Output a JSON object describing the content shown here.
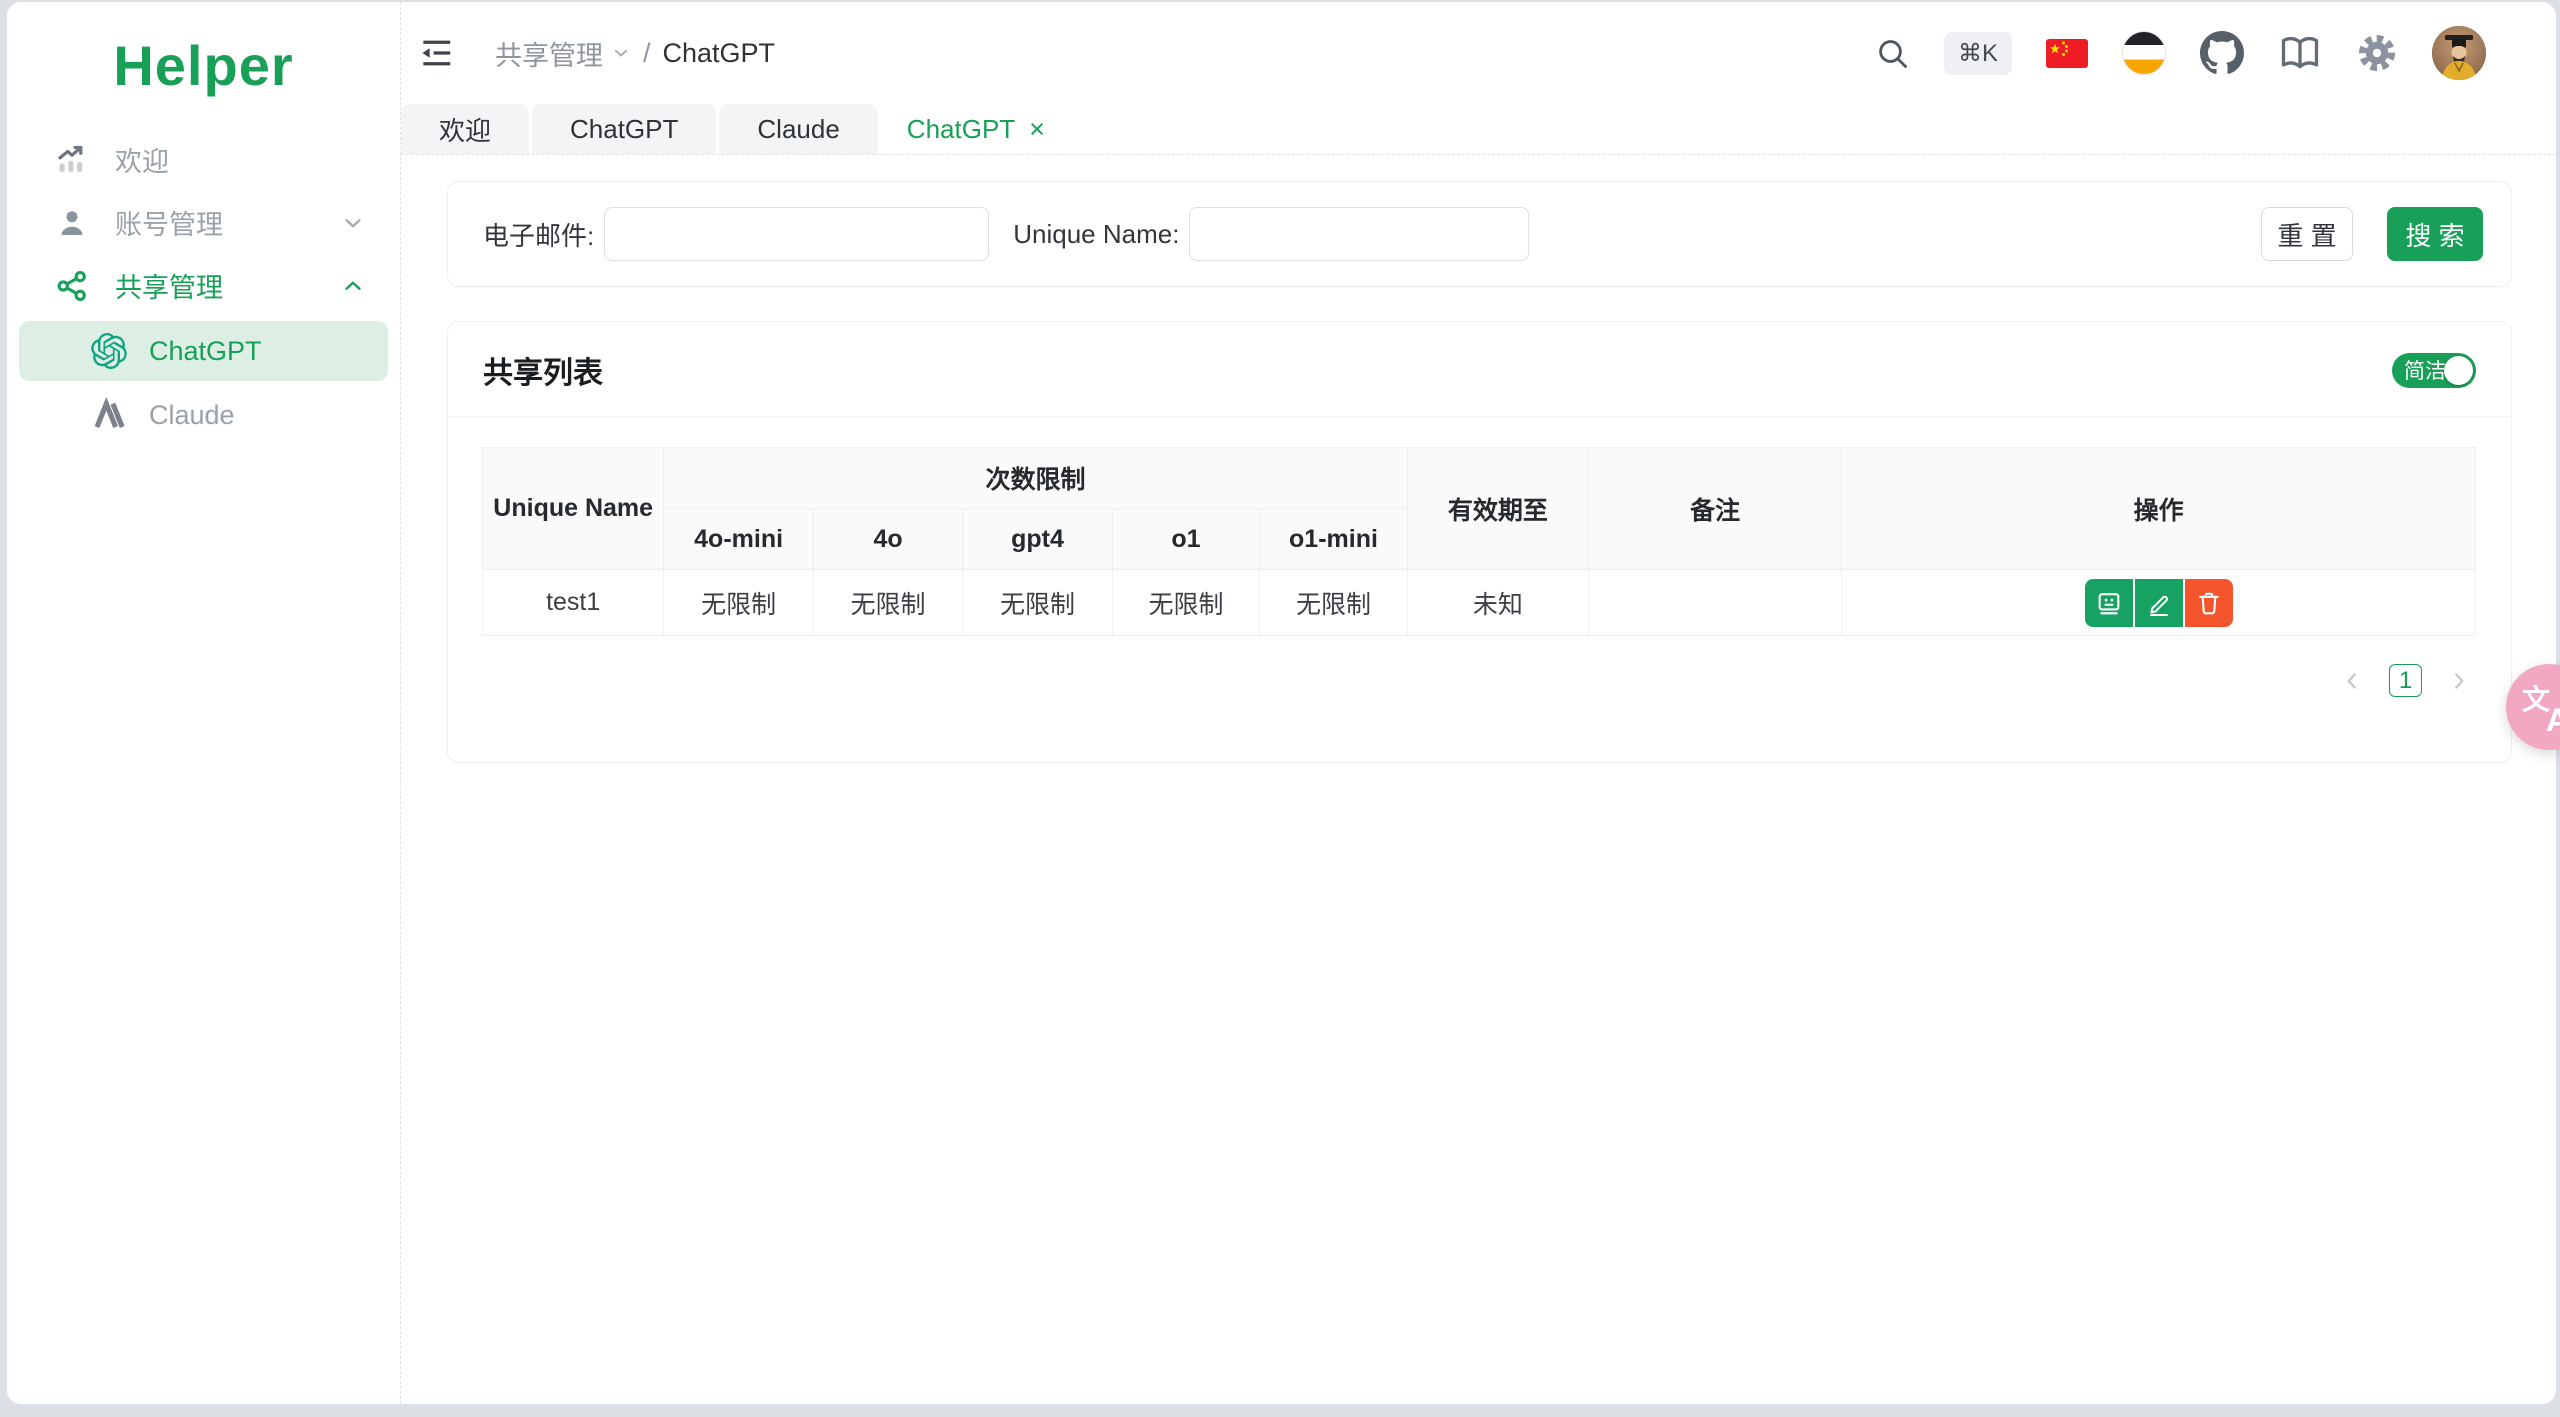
{
  "app": {
    "logo": "Helper"
  },
  "sidebar": {
    "items": [
      {
        "label": "欢迎",
        "icon": "trend-chart-icon"
      },
      {
        "label": "账号管理",
        "icon": "user-icon",
        "chevron": "down"
      },
      {
        "label": "共享管理",
        "icon": "share-icon",
        "chevron": "up"
      }
    ],
    "subitems": [
      {
        "label": "ChatGPT",
        "icon": "openai-icon",
        "active": true
      },
      {
        "label": "Claude",
        "icon": "anthropic-icon",
        "active": false
      }
    ]
  },
  "header": {
    "breadcrumb": {
      "section": "共享管理",
      "sep": "/",
      "page": "ChatGPT"
    },
    "shortcut": "⌘K",
    "icons": [
      "search-icon",
      "shortcut-badge",
      "flag-china-icon",
      "flag-circle-icon",
      "github-icon",
      "docs-book-icon",
      "gear-icon",
      "user-avatar"
    ]
  },
  "tabs": [
    {
      "label": "欢迎",
      "active": false
    },
    {
      "label": "ChatGPT",
      "active": false
    },
    {
      "label": "Claude",
      "active": false
    },
    {
      "label": "ChatGPT",
      "active": true,
      "close": "×"
    }
  ],
  "filter": {
    "email_label": "电子邮件:",
    "email_value": "",
    "unique_label": "Unique Name:",
    "unique_value": "",
    "reset": "重 置",
    "search": "搜 索"
  },
  "list": {
    "title": "共享列表",
    "toggle_label": "简洁",
    "toggle_on": true
  },
  "table": {
    "col_unique": "Unique Name",
    "col_limit": "次数限制",
    "sub_cols": [
      "4o-mini",
      "4o",
      "gpt4",
      "o1",
      "o1-mini"
    ],
    "col_expiry": "有效期至",
    "col_note": "备注",
    "col_actions": "操作",
    "rows": [
      {
        "unique": "test1",
        "limits": [
          "无限制",
          "无限制",
          "无限制",
          "无限制",
          "无限制"
        ],
        "expiry": "未知",
        "note": "",
        "actions": [
          "session-card-button",
          "edit-button",
          "delete-button"
        ]
      }
    ]
  },
  "pagination": {
    "page": "1"
  },
  "fab": {
    "zh": "文",
    "en": "A"
  },
  "colors": {
    "primary": "#18a058",
    "active_bg": "#ddefe5",
    "danger": "#f5552d",
    "pink_fab": "#f2a7c3",
    "openai": "#10a37f"
  }
}
